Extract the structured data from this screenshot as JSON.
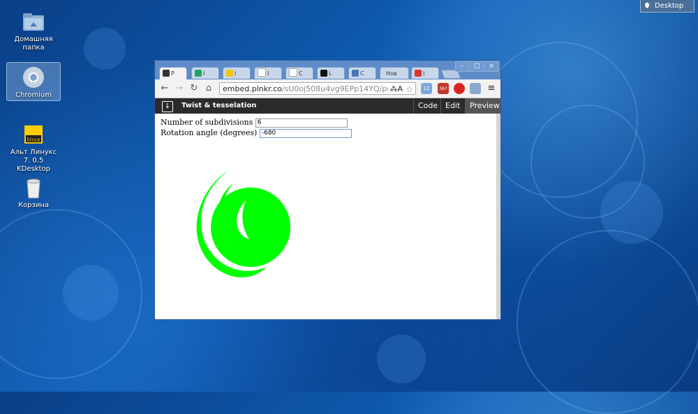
{
  "desktop": {
    "icons": [
      {
        "label": "Домашняя папка",
        "icon": "home-folder-icon"
      },
      {
        "label": "Chromium",
        "icon": "chromium-icon"
      },
      {
        "label": "Альт Линукс 7. 0.5 KDesktop",
        "icon": "alt-linux-icon"
      },
      {
        "label": "Корзина",
        "icon": "trash-icon"
      }
    ],
    "show_desktop_label": "Desktop"
  },
  "browser": {
    "tabs": [
      {
        "label": "P",
        "icon": "download-favicon",
        "active": true
      },
      {
        "label": "I",
        "icon": "sheets-favicon"
      },
      {
        "label": "I",
        "icon": "alt-linux-favicon"
      },
      {
        "label": "I",
        "icon": "page-favicon"
      },
      {
        "label": "C",
        "icon": "page-favicon"
      },
      {
        "label": "L",
        "icon": "l-favicon"
      },
      {
        "label": "C",
        "icon": "b-favicon"
      },
      {
        "label": "Нов",
        "icon": "none"
      },
      {
        "label": "I",
        "icon": "red-favicon"
      }
    ],
    "window_buttons": [
      "–",
      "□",
      "×"
    ],
    "url_host": "embed.plnkr.co",
    "url_path": "/sU0oj508u4vg9EPp14YQ/pr",
    "url_tail": "⁂A",
    "extensions": [
      {
        "name": "cloud-icon",
        "badge": "12"
      },
      {
        "name": "gmail-icon",
        "badge": "367"
      },
      {
        "name": "opera-icon",
        "badge": ""
      },
      {
        "name": "cloud-gear-icon",
        "badge": ""
      }
    ]
  },
  "plunker": {
    "title": "Twist & tesselation",
    "buttons": [
      "Code",
      "Edit",
      "Preview"
    ],
    "active_button": "Preview"
  },
  "form": {
    "subdivisions_label": "Number of subdivisions",
    "subdivisions_value": "6",
    "angle_label": "Rotation angle (degrees)",
    "angle_value": "-680"
  },
  "colors": {
    "accent": "#00ff00",
    "plunker_bar": "#2b2b2b",
    "window_frame": "#5d8cc9"
  }
}
